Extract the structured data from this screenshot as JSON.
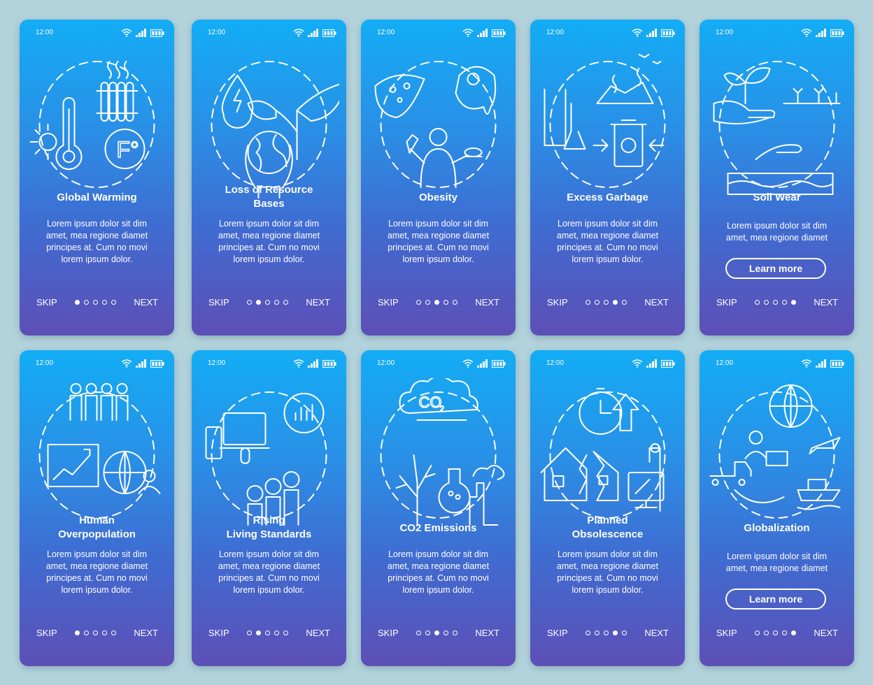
{
  "status_bar": {
    "time": "12:00",
    "icons": [
      "wifi-icon",
      "signal-icon",
      "battery-icon"
    ]
  },
  "nav": {
    "skip_label": "SKIP",
    "next_label": "NEXT",
    "dot_count": 5
  },
  "screens": [
    {
      "title_lines": [
        "Global Warming"
      ],
      "illustration": "global-warming-illustration",
      "desc_lines": [
        "Lorem ipsum dolor sit dim",
        "amet, mea regione diamet",
        "principes at. Cum no movi",
        "lorem ipsum dolor."
      ],
      "active_dot": 1,
      "learn_more": null
    },
    {
      "title_lines": [
        "Loss of Resource",
        "Bases"
      ],
      "illustration": "resource-loss-illustration",
      "desc_lines": [
        "Lorem ipsum dolor sit dim",
        "amet, mea regione diamet",
        "principes at. Cum no movi",
        "lorem ipsum dolor."
      ],
      "active_dot": 2,
      "learn_more": null
    },
    {
      "title_lines": [
        "Obesity"
      ],
      "illustration": "obesity-illustration",
      "desc_lines": [
        "Lorem ipsum dolor sit dim",
        "amet, mea regione diamet",
        "principes at. Cum no movi",
        "lorem ipsum dolor."
      ],
      "active_dot": 3,
      "learn_more": null
    },
    {
      "title_lines": [
        "Excess Garbage"
      ],
      "illustration": "garbage-illustration",
      "desc_lines": [
        "Lorem ipsum dolor sit dim",
        "amet, mea regione diamet",
        "principes at. Cum no movi",
        "lorem ipsum dolor."
      ],
      "active_dot": 4,
      "learn_more": null
    },
    {
      "title_lines": [
        "Soil Wear"
      ],
      "illustration": "soil-wear-illustration",
      "desc_lines": [
        "Lorem ipsum dolor sit dim",
        "amet, mea regione diamet"
      ],
      "active_dot": 5,
      "learn_more": "Learn more"
    },
    {
      "title_lines": [
        "Human",
        "Overpopulation"
      ],
      "illustration": "overpopulation-illustration",
      "desc_lines": [
        "Lorem ipsum dolor sit dim",
        "amet, mea regione diamet",
        "principes at. Cum no movi",
        "lorem ipsum dolor."
      ],
      "active_dot": 1,
      "learn_more": null
    },
    {
      "title_lines": [
        "Rising",
        "Living Standards"
      ],
      "illustration": "living-standards-illustration",
      "desc_lines": [
        "Lorem ipsum dolor sit dim",
        "amet, mea regione diamet",
        "principes at. Cum no movi",
        "lorem ipsum dolor."
      ],
      "active_dot": 2,
      "learn_more": null
    },
    {
      "title_lines": [
        "CO2 Emissions"
      ],
      "illustration": "co2-emissions-illustration",
      "desc_lines": [
        "Lorem ipsum dolor sit dim",
        "amet, mea regione diamet",
        "principes at. Cum no movi",
        "lorem ipsum dolor."
      ],
      "active_dot": 3,
      "learn_more": null
    },
    {
      "title_lines": [
        "Planned",
        "Obsolescence"
      ],
      "illustration": "planned-obsolescence-illustration",
      "desc_lines": [
        "Lorem ipsum dolor sit dim",
        "amet, mea regione diamet",
        "principes at. Cum no movi",
        "lorem ipsum dolor."
      ],
      "active_dot": 4,
      "learn_more": null
    },
    {
      "title_lines": [
        "Globalization"
      ],
      "illustration": "globalization-illustration",
      "desc_lines": [
        "Lorem ipsum dolor sit dim",
        "amet, mea regione diamet"
      ],
      "active_dot": 5,
      "learn_more": "Learn more"
    }
  ],
  "illustration_text": {
    "fahrenheit": "F°",
    "co2": "CO",
    "co2_sub": "2"
  }
}
